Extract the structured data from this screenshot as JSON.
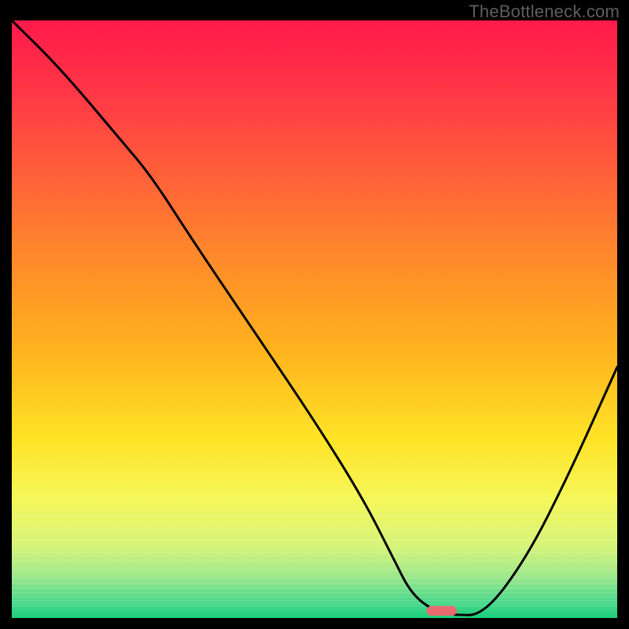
{
  "watermark": "TheBottleneck.com",
  "chart_data": {
    "type": "line",
    "title": "",
    "xlabel": "",
    "ylabel": "",
    "xlim": [
      0,
      100
    ],
    "ylim": [
      0,
      100
    ],
    "series": [
      {
        "name": "bottleneck-curve",
        "x": [
          0,
          8,
          18,
          23,
          30,
          40,
          50,
          58,
          63,
          66,
          70,
          73,
          78,
          85,
          92,
          100
        ],
        "values": [
          100,
          92,
          80,
          74,
          63,
          48,
          33,
          20,
          10,
          4,
          1,
          0.5,
          0.5,
          10,
          24,
          42
        ]
      }
    ],
    "marker": {
      "x": 71,
      "y": 1.2,
      "color": "#e96a6f",
      "width_pct": 5,
      "height_pct": 1.6
    },
    "gradient_stops": [
      {
        "offset": 0,
        "color": "#ff1a4a"
      },
      {
        "offset": 12,
        "color": "#ff3746"
      },
      {
        "offset": 25,
        "color": "#ff5e3a"
      },
      {
        "offset": 40,
        "color": "#ff8a2a"
      },
      {
        "offset": 55,
        "color": "#ffb21e"
      },
      {
        "offset": 70,
        "color": "#ffe326"
      },
      {
        "offset": 80,
        "color": "#f6f75a"
      },
      {
        "offset": 88,
        "color": "#d6f47a"
      },
      {
        "offset": 93,
        "color": "#9fe88c"
      },
      {
        "offset": 97,
        "color": "#4fd98a"
      },
      {
        "offset": 100,
        "color": "#1ccf7e"
      }
    ],
    "band_lines_y_pct": [
      83,
      85,
      87,
      89,
      90.5,
      92,
      93.2,
      94.2,
      95,
      95.8,
      96.5,
      97.1,
      97.6,
      98.0
    ]
  }
}
